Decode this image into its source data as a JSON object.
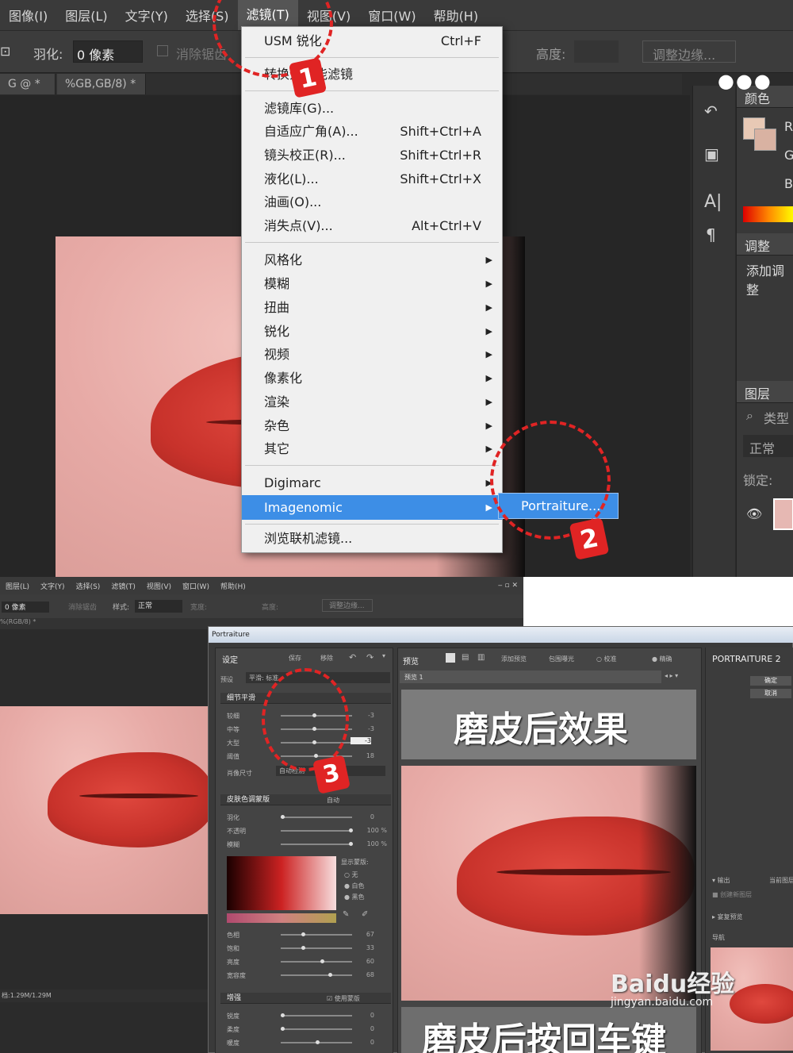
{
  "top": {
    "menubar": [
      "图像(I)",
      "图层(L)",
      "文字(Y)",
      "选择(S)",
      "滤镜(T)",
      "视图(V)",
      "窗口(W)",
      "帮助(H)"
    ],
    "options": {
      "feather_label": "羽化:",
      "feather_value": "0 像素",
      "antialias": "消除锯齿",
      "height_label": "高度:",
      "refine_edge": "调整边缘..."
    },
    "tabs": [
      "G @ *",
      "%GB,GB/8) *"
    ],
    "filter_menu": {
      "items": [
        {
          "label": "USM 锐化",
          "shortcut": "Ctrl+F"
        },
        {
          "label": "转换为智能滤镜",
          "shortcut": ""
        },
        {
          "label": "滤镜库(G)...",
          "shortcut": ""
        },
        {
          "label": "自适应广角(A)...",
          "shortcut": "Shift+Ctrl+A"
        },
        {
          "label": "镜头校正(R)...",
          "shortcut": "Shift+Ctrl+R"
        },
        {
          "label": "液化(L)...",
          "shortcut": "Shift+Ctrl+X"
        },
        {
          "label": "油画(O)...",
          "shortcut": ""
        },
        {
          "label": "消失点(V)...",
          "shortcut": "Alt+Ctrl+V"
        },
        {
          "label": "风格化",
          "shortcut": ""
        },
        {
          "label": "模糊",
          "shortcut": ""
        },
        {
          "label": "扭曲",
          "shortcut": ""
        },
        {
          "label": "锐化",
          "shortcut": ""
        },
        {
          "label": "视频",
          "shortcut": ""
        },
        {
          "label": "像素化",
          "shortcut": ""
        },
        {
          "label": "渲染",
          "shortcut": ""
        },
        {
          "label": "杂色",
          "shortcut": ""
        },
        {
          "label": "其它",
          "shortcut": ""
        },
        {
          "label": "Digimarc",
          "shortcut": ""
        },
        {
          "label": "Imagenomic",
          "shortcut": ""
        },
        {
          "label": "浏览联机滤镜...",
          "shortcut": ""
        }
      ],
      "submenu_item": "Portraiture..."
    },
    "right_panel": {
      "color_tab": "颜色",
      "rgb": [
        "R",
        "G",
        "B"
      ],
      "adjust_tab": "调整",
      "add_adjust": "添加调整",
      "layers_tab": "图层",
      "kind": "类型",
      "blend_mode": "正常",
      "lock": "锁定:"
    },
    "annotations": [
      "1",
      "2"
    ]
  },
  "bottom": {
    "menubar": [
      "图层(L)",
      "文字(Y)",
      "选择(S)",
      "滤镜(T)",
      "视图(V)",
      "窗口(W)",
      "帮助(H)"
    ],
    "options": {
      "feather": "0 像素",
      "antialias": "消除锯齿",
      "style_label": "样式:",
      "style_value": "正常",
      "width": "宽度:",
      "height": "高度:",
      "refine": "调整边缘..."
    },
    "tab": "%(RGB/8) *",
    "status": "档:1.29M/1.29M",
    "portraiture": {
      "title": "Portraiture",
      "settings_label": "设定",
      "save": "保存",
      "delete": "移除",
      "preset_label": "预设",
      "preset_value": "平滑: 标准",
      "section_detail": "细节平滑",
      "detail_rows": [
        {
          "label": "较细",
          "value": "-3"
        },
        {
          "label": "中等",
          "value": "-3"
        },
        {
          "label": "大型",
          "value": "-3"
        },
        {
          "label": "阈值",
          "value": "18"
        }
      ],
      "portrait_size_label": "肖像尺寸",
      "portrait_size_value": "自动检测",
      "section_skin": "皮肤色调蒙版",
      "skin_mode": "自动",
      "skin_rows": [
        {
          "label": "羽化",
          "value": "0"
        },
        {
          "label": "不透明",
          "value": "100 %"
        },
        {
          "label": "模糊",
          "value": "100 %"
        }
      ],
      "show_mask": "显示蒙版:",
      "mask_options": [
        "无",
        "白色",
        "黑色"
      ],
      "tone_rows": [
        {
          "label": "色相",
          "value": "67"
        },
        {
          "label": "饱和",
          "value": "33"
        },
        {
          "label": "亮度",
          "value": "60"
        },
        {
          "label": "宽容度",
          "value": "68"
        }
      ],
      "section_enhance": "增强",
      "use_mask": "使用蒙版",
      "enhance_rows": [
        {
          "label": "锐度",
          "value": "0"
        },
        {
          "label": "柔度",
          "value": "0"
        },
        {
          "label": "暖度",
          "value": "0"
        }
      ],
      "preview_label": "预览",
      "add_compare": "添加预览",
      "clip": "包围曝光",
      "original": "校准",
      "fine": "精确",
      "preview_tab": "预览 1",
      "brand": "PORTRAITURE 2",
      "ok": "确定",
      "cancel": "取消",
      "output": "输出",
      "output_mode": "当前图层",
      "new_layer": "创建新图层",
      "compare": "宴复预览",
      "nav": "导航",
      "overlay_top": "磨皮后效果",
      "overlay_bottom": "磨皮后按回车键"
    },
    "annotation": "3",
    "watermark": "Baidu经验",
    "watermark_url": "jingyan.baidu.com"
  }
}
